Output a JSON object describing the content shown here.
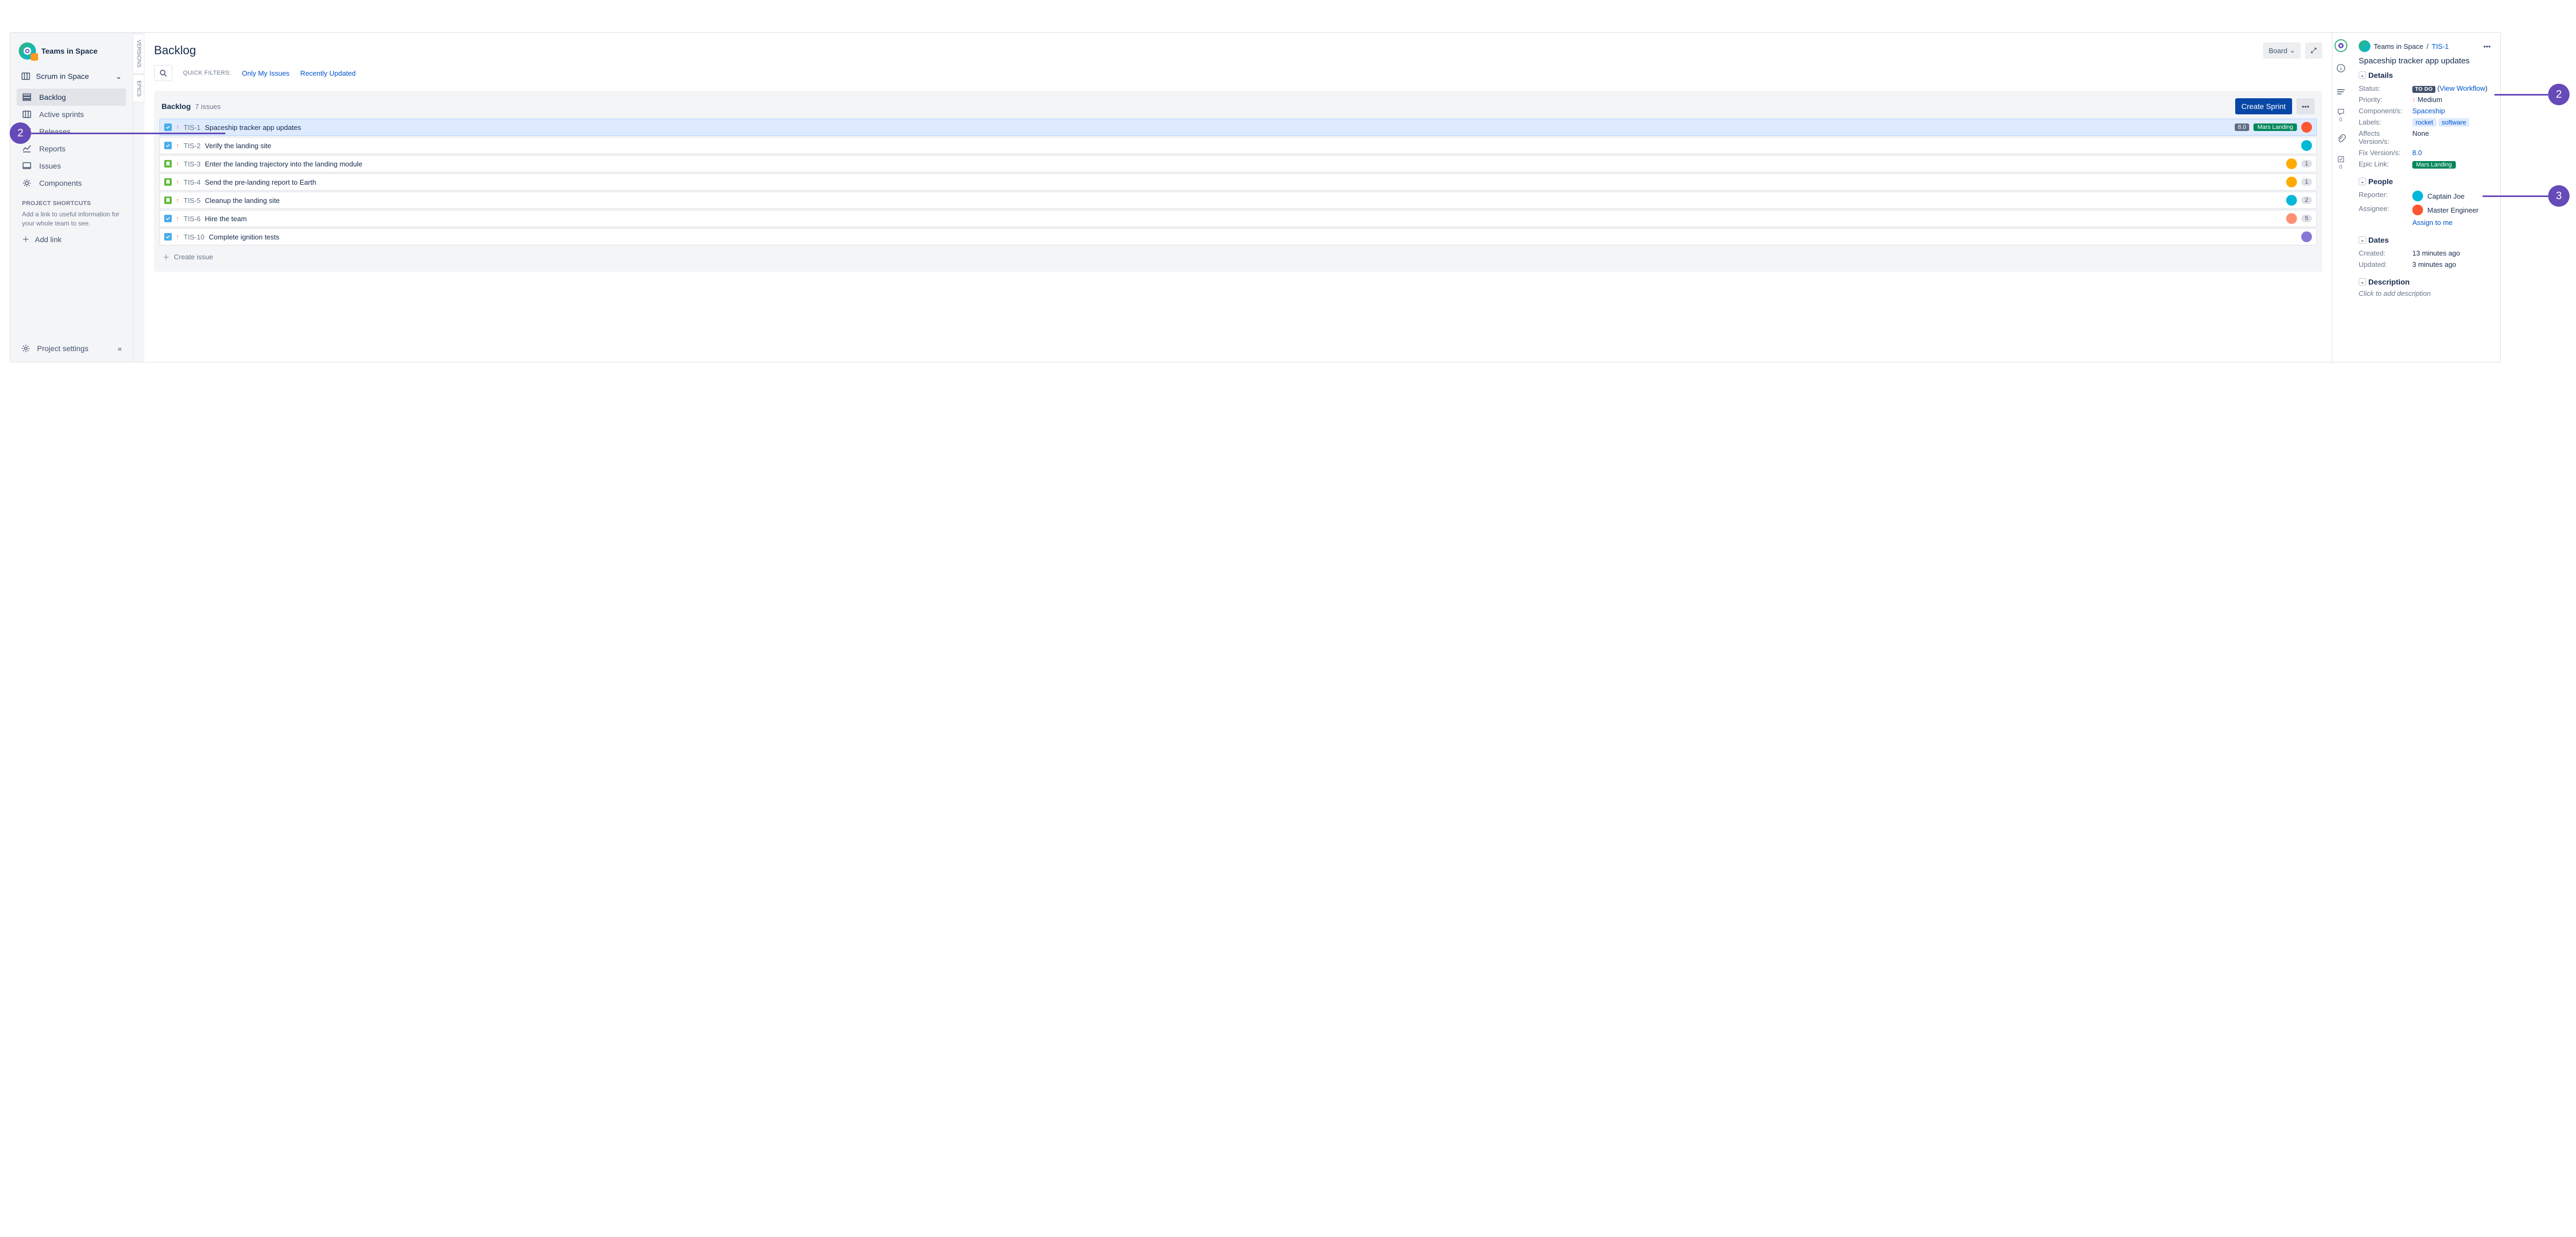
{
  "project": {
    "name": "Teams in Space",
    "board_select": "Scrum in Space"
  },
  "sidebar": {
    "items": [
      {
        "label": "Backlog"
      },
      {
        "label": "Active sprints"
      },
      {
        "label": "Releases"
      },
      {
        "label": "Reports"
      },
      {
        "label": "Issues"
      },
      {
        "label": "Components"
      }
    ],
    "shortcuts_title": "PROJECT SHORTCUTS",
    "shortcuts_helper": "Add a link to useful information for your whole team to see.",
    "add_link": "Add link",
    "settings": "Project settings"
  },
  "vtabs": {
    "versions": "VERSIONS",
    "epics": "EPICS"
  },
  "header": {
    "title": "Backlog",
    "board_btn": "Board",
    "filters_label": "QUICK FILTERS:",
    "filter1": "Only My Issues",
    "filter2": "Recently Updated"
  },
  "backlog": {
    "title": "Backlog",
    "count": "7 issues",
    "create_sprint": "Create Sprint",
    "create_issue": "Create issue",
    "issues": [
      {
        "type": "task",
        "key": "TIS-1",
        "summary": "Spaceship tracker app updates",
        "version": "8.0",
        "epic": "Mars Landing",
        "avatar": "#FF5630",
        "count": ""
      },
      {
        "type": "task",
        "key": "TIS-2",
        "summary": "Verify the landing site",
        "version": "",
        "epic": "",
        "avatar": "#00B8D9",
        "count": ""
      },
      {
        "type": "story",
        "key": "TIS-3",
        "summary": "Enter the landing trajectory into the landing module",
        "version": "",
        "epic": "",
        "avatar": "#FFAB00",
        "count": "1"
      },
      {
        "type": "story",
        "key": "TIS-4",
        "summary": "Send the pre-landing report to Earth",
        "version": "",
        "epic": "",
        "avatar": "#FFAB00",
        "count": "1"
      },
      {
        "type": "story",
        "key": "TIS-5",
        "summary": "Cleanup the landing site",
        "version": "",
        "epic": "",
        "avatar": "#00B8D9",
        "count": "2"
      },
      {
        "type": "task",
        "key": "TIS-6",
        "summary": "Hire the team",
        "version": "",
        "epic": "",
        "avatar": "#FF8F73",
        "count": "5"
      },
      {
        "type": "task",
        "key": "TIS-10",
        "summary": "Complete ignition tests",
        "version": "",
        "epic": "",
        "avatar": "#8777D9",
        "count": ""
      }
    ]
  },
  "activity": {
    "comments_count": "0",
    "checklist_count": "0"
  },
  "details": {
    "breadcrumb_project": "Teams in Space",
    "breadcrumb_key": "TIS-1",
    "title": "Spaceship tracker app updates",
    "sections": {
      "details": "Details",
      "people": "People",
      "dates": "Dates",
      "description": "Description"
    },
    "fields": {
      "status_label": "Status:",
      "status_value": "TO DO",
      "status_workflow": "View Workflow",
      "priority_label": "Priority:",
      "priority_value": "Medium",
      "components_label": "Component/s:",
      "components_value": "Spaceship",
      "labels_label": "Labels:",
      "labels_v1": "rocket",
      "labels_v2": "software",
      "affects_label": "Affects Version/s:",
      "affects_value": "None",
      "fixv_label": "Fix Version/s:",
      "fixv_value": "8.0",
      "epic_label": "Epic Link:",
      "epic_value": "Mars Landing",
      "reporter_label": "Reporter:",
      "reporter_value": "Captain Joe",
      "assignee_label": "Assignee:",
      "assignee_value": "Master Engineer",
      "assign_me": "Assign to me",
      "created_label": "Created:",
      "created_value": "13 minutes ago",
      "updated_label": "Updated:",
      "updated_value": "3 minutes ago",
      "desc_placeholder": "Click to add description"
    }
  },
  "annotations": {
    "n1": "2",
    "n2": "2",
    "n3": "3"
  }
}
